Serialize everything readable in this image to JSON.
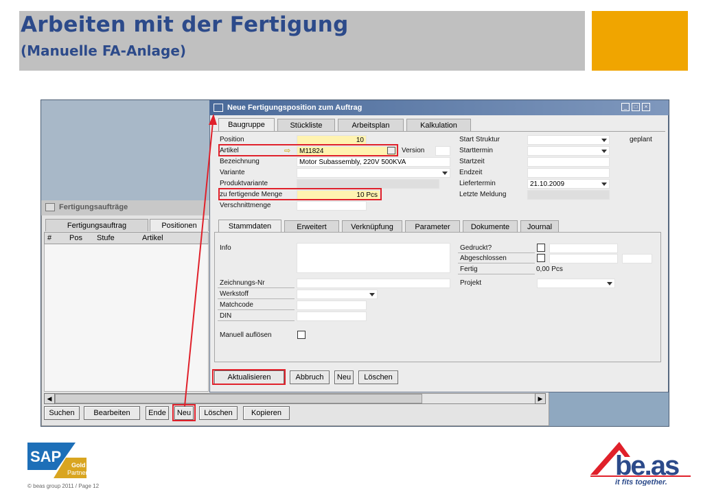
{
  "slide": {
    "title": "Arbeiten mit der Fertigung",
    "subtitle": "(Manuelle FA-Anlage)",
    "footer": "© beas group 2011 / Page 12",
    "sap_logo_text": {
      "sap": "SAP",
      "gold": "Gold",
      "partner": "Partner"
    },
    "beas_logo_text": {
      "name": "be.as",
      "tagline": "it fits together."
    }
  },
  "colors": {
    "title": "#2c4a8a",
    "accent": "#f0a500",
    "highlight": "#e0202a",
    "required_field": "#fff3b0"
  },
  "back_window": {
    "title": "Fertigungsaufträge",
    "tabs": [
      "Fertigungsauftrag",
      "Positionen"
    ],
    "columns": [
      "#",
      "Pos",
      "Stufe",
      "Artikel"
    ],
    "buttons": [
      "Suchen",
      "Bearbeiten",
      "Ende",
      "Neu",
      "Löschen",
      "Kopieren"
    ]
  },
  "dialog": {
    "title": "Neue Fertigungsposition zum Auftrag",
    "tabs": [
      "Baugruppe",
      "Stückliste",
      "Arbeitsplan",
      "Kalkulation"
    ],
    "left_fields": {
      "position": {
        "label": "Position",
        "value": "10"
      },
      "artikel": {
        "label": "Artikel",
        "value": "M11824"
      },
      "bezeichnung": {
        "label": "Bezeichnung",
        "value": "Motor Subassembly, 220V 500KVA"
      },
      "variante": {
        "label": "Variante",
        "value": ""
      },
      "produktvariante": {
        "label": "Produktvariante",
        "value": ""
      },
      "menge": {
        "label": "zu fertigende Menge",
        "value": "10 Pcs"
      },
      "verschnitt": {
        "label": "Verschnittmenge",
        "value": ""
      }
    },
    "version_label": "Version",
    "right_fields": {
      "start_struktur": {
        "label": "Start Struktur",
        "value": ""
      },
      "starttermin": {
        "label": "Starttermin",
        "value": ""
      },
      "startzeit": {
        "label": "Startzeit",
        "value": ""
      },
      "endzeit": {
        "label": "Endzeit",
        "value": ""
      },
      "liefertermin": {
        "label": "Liefertermin",
        "value": "21.10.2009"
      },
      "letzte_meldung": {
        "label": "Letzte Meldung",
        "value": ""
      }
    },
    "status": "geplant",
    "subtabs": [
      "Stammdaten",
      "Erweitert",
      "Verknüpfung",
      "Parameter",
      "Dokumente",
      "Journal"
    ],
    "stamm": {
      "info": "Info",
      "zeichnungs_nr": "Zeichnungs-Nr",
      "werkstoff": "Werkstoff",
      "matchcode": "Matchcode",
      "din": "DIN",
      "manuell_aufloesen": "Manuell auflösen",
      "gedruckt": "Gedruckt?",
      "abgeschlossen": "Abgeschlossen",
      "fertig_label": "Fertig",
      "fertig_value": "0,00 Pcs",
      "projekt": "Projekt"
    },
    "buttons": [
      "Aktualisieren",
      "Abbruch",
      "Neu",
      "Löschen"
    ]
  }
}
